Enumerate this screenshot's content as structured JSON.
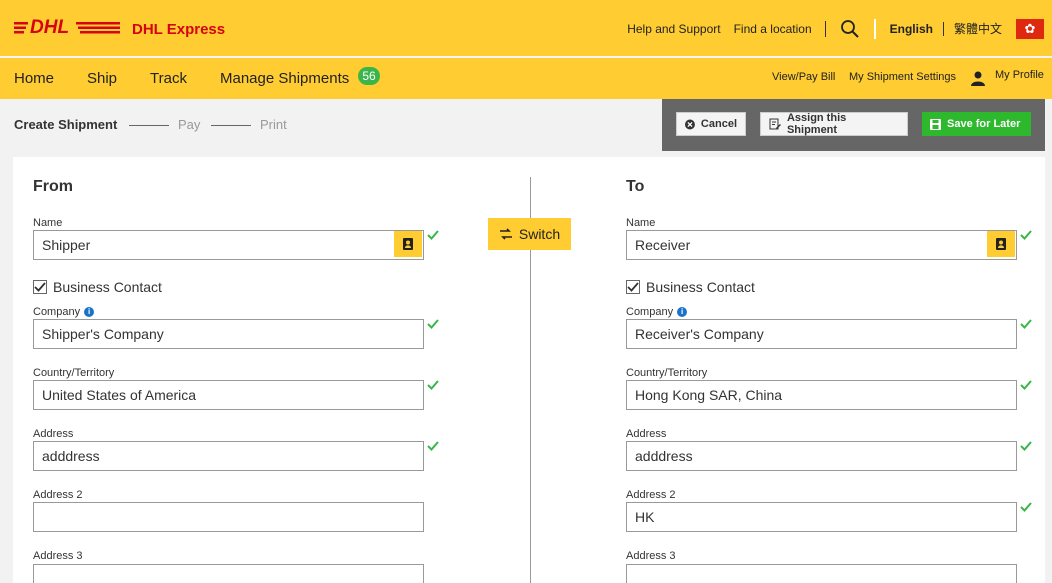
{
  "header": {
    "brand": "DHL Express",
    "links": [
      "Help and Support",
      "Find a location"
    ],
    "lang_active": "English",
    "lang_other": "繁體中文",
    "flag_glyph": "✿"
  },
  "nav": {
    "items": [
      "Home",
      "Ship",
      "Track",
      "Manage Shipments"
    ],
    "badge": "56",
    "right": [
      "View/Pay Bill",
      "My Shipment Settings",
      "My Profile"
    ]
  },
  "steps": [
    "Create Shipment",
    "Pay",
    "Print"
  ],
  "actions": {
    "cancel": "Cancel",
    "assign": "Assign this Shipment",
    "save": "Save for Later"
  },
  "switch_label": "Switch",
  "from": {
    "title": "From",
    "name_label": "Name",
    "name": "Shipper",
    "business_contact": "Business Contact",
    "company_label": "Company",
    "company": "Shipper's Company",
    "country_label": "Country/Territory",
    "country": "United States of America",
    "address_label": "Address",
    "address": "adddress",
    "address2_label": "Address 2",
    "address2": "",
    "address3_label": "Address 3",
    "address3": ""
  },
  "to": {
    "title": "To",
    "name_label": "Name",
    "name": "Receiver",
    "business_contact": "Business Contact",
    "company_label": "Company",
    "company": "Receiver's Company",
    "country_label": "Country/Territory",
    "country": "Hong Kong SAR, China",
    "address_label": "Address",
    "address": "adddress",
    "address2_label": "Address 2",
    "address2": "HK",
    "address3_label": "Address 3",
    "address3": ""
  },
  "colors": {
    "dhl_yellow": "#ffcc32",
    "dhl_red": "#d40511",
    "success_green": "#39b54a"
  }
}
